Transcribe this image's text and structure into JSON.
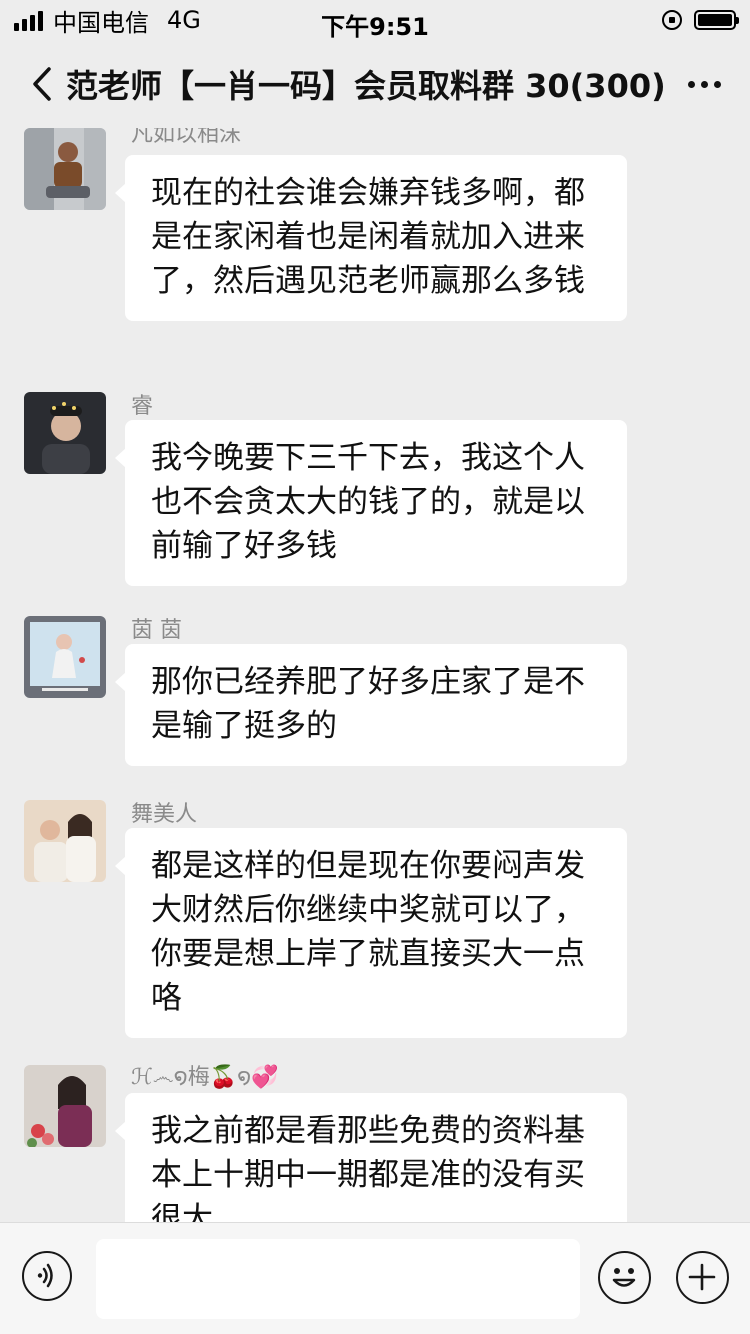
{
  "status_bar": {
    "carrier": "中国电信",
    "network": "4G",
    "time": "下午9:51"
  },
  "header": {
    "title": "范老师【一肖一码】会员取料群 30(300)"
  },
  "messages": [
    {
      "sender": "凡如以相沫",
      "text": "现在的社会谁会嫌弃钱多啊，都是在家闲着也是闲着就加入进来了，然后遇见范老师赢那么多钱"
    },
    {
      "sender": "睿",
      "text": "我今晚要下三千下去，我这个人也不会贪太大的钱了的，就是以前输了好多钱"
    },
    {
      "sender": "茵 茵",
      "text": "那你已经养肥了好多庄家了是不是输了挺多的"
    },
    {
      "sender": "舞美人",
      "text": "都是这样的但是现在你要闷声发大财然后你继续中奖就可以了，你要是想上岸了就直接买大一点咯"
    },
    {
      "sender": "ℋ෴໑梅🍒໑💞",
      "text": "我之前都是看那些免费的资料基本上十期中一期都是准的没有买很大"
    }
  ],
  "input_bar": {
    "placeholder": "",
    "voice_icon": "voice-icon",
    "emoji_icon": "emoji-icon",
    "plus_icon": "plus-icon"
  }
}
